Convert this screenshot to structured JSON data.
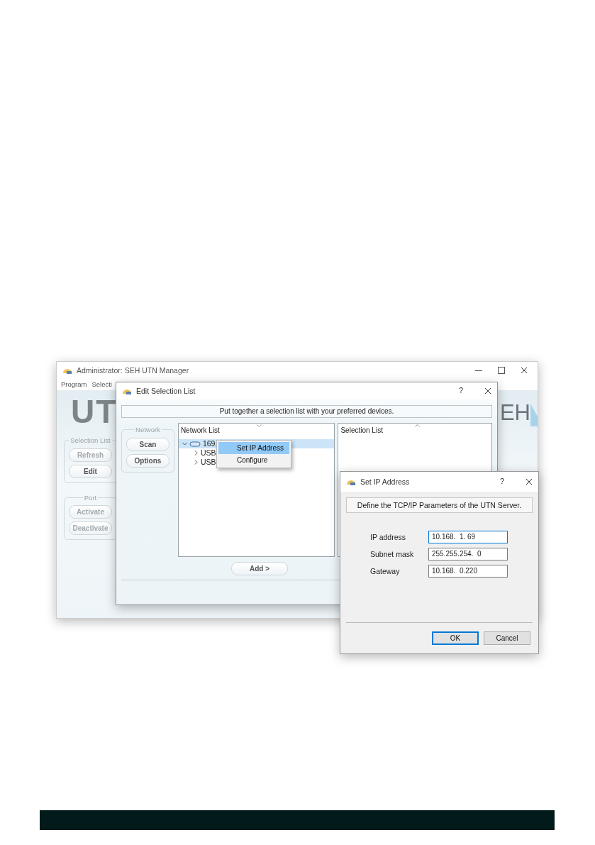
{
  "main_window": {
    "title": "Administrator: SEH UTN Manager",
    "menu": [
      "Program",
      "Selecti"
    ],
    "logo_left": "UT",
    "logo_right": "EH",
    "groups": [
      {
        "legend": "Selection List",
        "buttons": [
          {
            "label": "Refresh",
            "disabled": true
          },
          {
            "label": "Edit",
            "disabled": false
          }
        ]
      },
      {
        "legend": "Port",
        "buttons": [
          {
            "label": "Activate",
            "disabled": true
          },
          {
            "label": "Deactivate",
            "disabled": true
          }
        ]
      }
    ]
  },
  "edit_dialog": {
    "title": "Edit Selection List",
    "help": "?",
    "banner": "Put together a selection list with your preferred devices.",
    "network_group": {
      "legend": "Network",
      "buttons": [
        {
          "label": "Scan",
          "disabled": false
        },
        {
          "label": "Options",
          "disabled": false
        }
      ]
    },
    "network_list": {
      "title": "Network List",
      "tree": [
        {
          "label": "169.",
          "expanded": true,
          "selected": true,
          "children": [
            {
              "label": "USB",
              "expanded": false,
              "selected": false
            },
            {
              "label": "USB",
              "expanded": false,
              "selected": false
            }
          ]
        }
      ]
    },
    "selection_list": {
      "title": "Selection List"
    },
    "add_button": "Add >"
  },
  "context_menu": [
    {
      "label": "Set IP Address",
      "selected": true
    },
    {
      "label": "Configure",
      "selected": false
    }
  ],
  "ip_dialog": {
    "title": "Set IP Address",
    "help": "?",
    "banner": "Define the TCP/IP Parameters of the UTN Server.",
    "fields": [
      {
        "label": "IP address",
        "value": "10.168.  1. 69",
        "focused": true
      },
      {
        "label": "Subnet mask",
        "value": "255.255.254.  0",
        "focused": false
      },
      {
        "label": "Gateway",
        "value": "10.168.  0.220",
        "focused": false
      }
    ],
    "buttons": [
      {
        "label": "OK",
        "default": true
      },
      {
        "label": "Cancel",
        "default": false
      }
    ]
  }
}
